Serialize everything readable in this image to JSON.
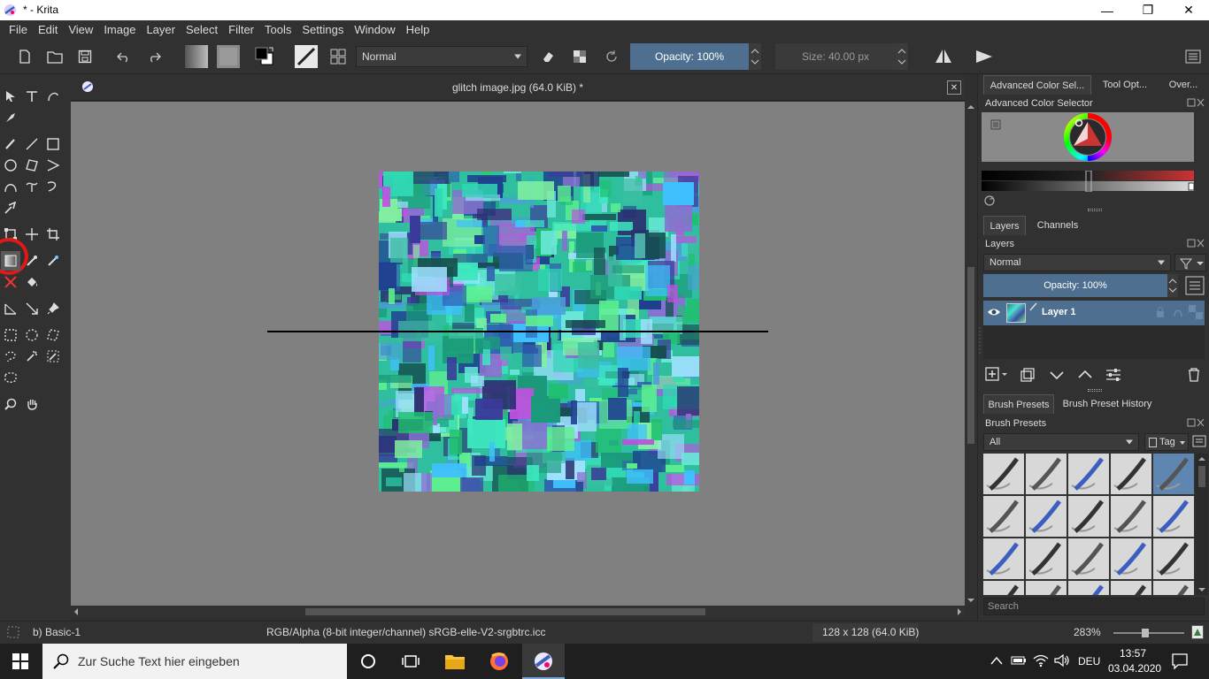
{
  "window": {
    "title": "* - Krita",
    "minimize_glyph": "—",
    "restore_glyph": "❐",
    "close_glyph": "✕"
  },
  "menu": [
    {
      "label": "File"
    },
    {
      "label": "Edit"
    },
    {
      "label": "View"
    },
    {
      "label": "Image"
    },
    {
      "label": "Layer"
    },
    {
      "label": "Select"
    },
    {
      "label": "Filter"
    },
    {
      "label": "Tools"
    },
    {
      "label": "Settings"
    },
    {
      "label": "Window"
    },
    {
      "label": "Help"
    }
  ],
  "toolbar": {
    "blend_mode": "Normal",
    "opacity": "Opacity: 100%",
    "size": "Size: 40.00 px"
  },
  "document": {
    "tab_title": "glitch image.jpg (64.0 KiB) *",
    "tab_close": "✕"
  },
  "dock": {
    "top_tabs": [
      {
        "label": "Advanced Color Sel..."
      },
      {
        "label": "Tool Opt..."
      },
      {
        "label": "Over..."
      }
    ],
    "color_selector_title": "Advanced Color Selector",
    "layers_tabs": [
      {
        "label": "Layers"
      },
      {
        "label": "Channels"
      }
    ],
    "layers_title": "Layers",
    "layer_blend_mode": "Normal",
    "layer_opacity": "Opacity:  100%",
    "layer_name": "Layer 1",
    "brush_tabs": [
      {
        "label": "Brush Presets"
      },
      {
        "label": "Brush Preset History"
      }
    ],
    "brush_title": "Brush Presets",
    "brush_filter": "All",
    "tag_label": "Tag",
    "search_placeholder": "Search"
  },
  "status": {
    "preset": "b) Basic-1",
    "color_model": "RGB/Alpha (8-bit integer/channel)  sRGB-elle-V2-srgbtrc.icc",
    "image_size": "128 x 128 (64.0 KiB)",
    "zoom": "283%"
  },
  "taskbar": {
    "search_placeholder": "Zur Suche Text hier eingeben",
    "language": "DEU",
    "time": "13:57",
    "date": "03.04.2020"
  },
  "colors": {
    "accent_blue": "#4a6a8a",
    "highlight_red": "#e01818",
    "canvas_grey": "#808080"
  }
}
